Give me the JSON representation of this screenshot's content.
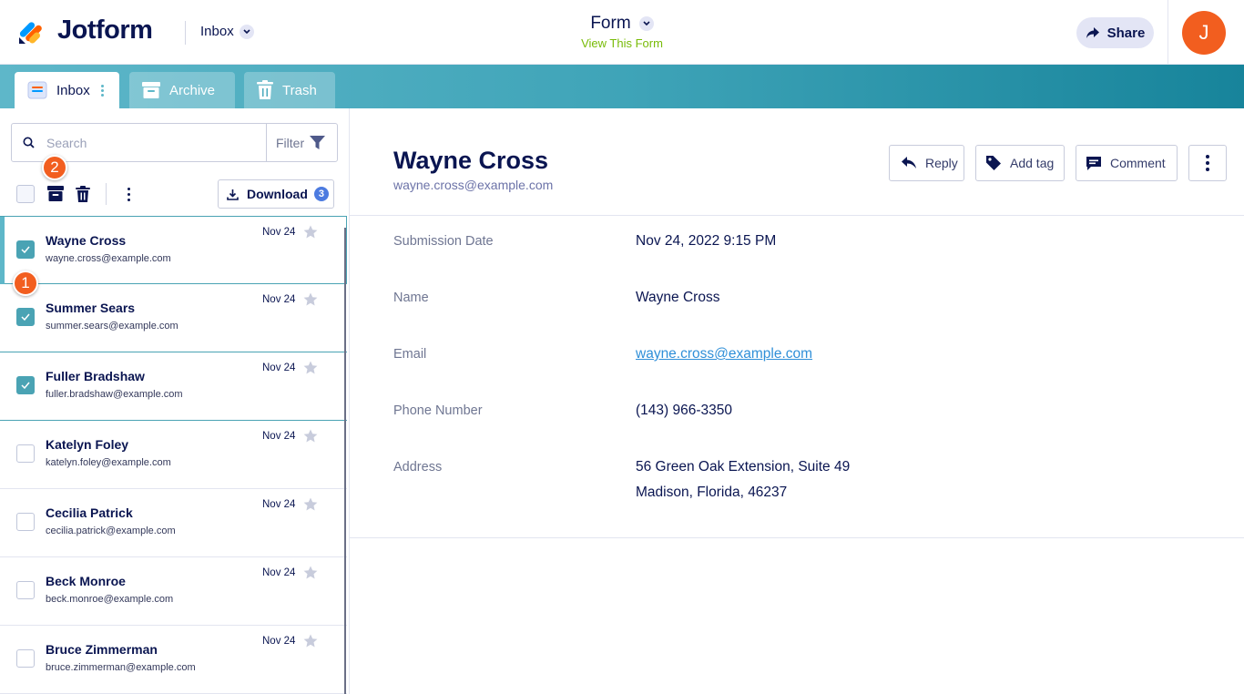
{
  "header": {
    "logo_text": "Jotform",
    "inbox_switch_label": "Inbox",
    "form_title": "Form",
    "view_form_label": "View This Form",
    "share_label": "Share",
    "avatar_initial": "J",
    "colors": {
      "brand_orange": "#f25e1f",
      "view_link": "#78bb07",
      "navy": "#0a1551"
    }
  },
  "tabs": [
    {
      "label": "Inbox",
      "icon": "inbox-icon",
      "active": true
    },
    {
      "label": "Archive",
      "icon": "archive-icon",
      "active": false
    },
    {
      "label": "Trash",
      "icon": "trash-icon",
      "active": false
    }
  ],
  "search": {
    "placeholder": "Search",
    "filter_label": "Filter"
  },
  "toolbar": {
    "download_label": "Download",
    "download_count": "3"
  },
  "markers": {
    "first": "1",
    "second": "2"
  },
  "submissions": [
    {
      "name": "Wayne Cross",
      "email": "wayne.cross@example.com",
      "date": "Nov 24",
      "checked": true
    },
    {
      "name": "Summer Sears",
      "email": "summer.sears@example.com",
      "date": "Nov 24",
      "checked": true
    },
    {
      "name": "Fuller Bradshaw",
      "email": "fuller.bradshaw@example.com",
      "date": "Nov 24",
      "checked": true
    },
    {
      "name": "Katelyn Foley",
      "email": "katelyn.foley@example.com",
      "date": "Nov 24",
      "checked": false
    },
    {
      "name": "Cecilia Patrick",
      "email": "cecilia.patrick@example.com",
      "date": "Nov 24",
      "checked": false
    },
    {
      "name": "Beck Monroe",
      "email": "beck.monroe@example.com",
      "date": "Nov 24",
      "checked": false
    },
    {
      "name": "Bruce Zimmerman",
      "email": "bruce.zimmerman@example.com",
      "date": "Nov 24",
      "checked": false
    }
  ],
  "detail": {
    "name": "Wayne Cross",
    "email": "wayne.cross@example.com",
    "actions": {
      "reply": "Reply",
      "add_tag": "Add tag",
      "comment": "Comment"
    },
    "fields": [
      {
        "label": "Submission Date",
        "value": "Nov 24, 2022 9:15 PM"
      },
      {
        "label": "Name",
        "value": "Wayne Cross"
      },
      {
        "label": "Email",
        "value": "wayne.cross@example.com"
      },
      {
        "label": "Phone Number",
        "value": "(143) 966-3350"
      },
      {
        "label": "Address",
        "value": "56 Green Oak Extension, Suite 49",
        "value2": "Madison, Florida, 46237"
      }
    ]
  }
}
